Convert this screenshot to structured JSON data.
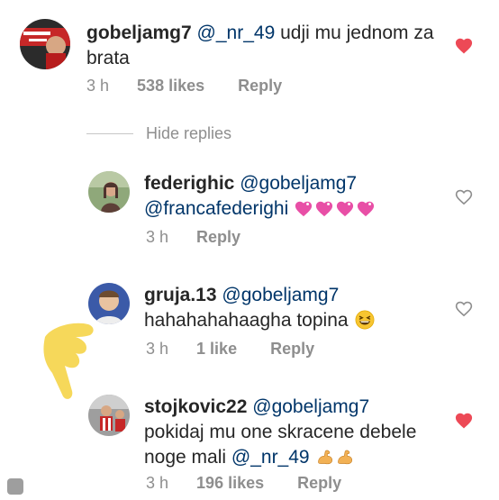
{
  "comments": [
    {
      "username": "gobeljamg7",
      "mention": "@_nr_49",
      "text_line1": " udji mu jednom za",
      "text_line2": "brata",
      "time": "3 h",
      "likes": "538 likes",
      "reply_label": "Reply",
      "liked": true
    }
  ],
  "hide_replies_label": "Hide replies",
  "replies": [
    {
      "username": "federighic",
      "mention": "@gobeljamg7",
      "mention2": "@francafederighi",
      "emoji": [
        "sparkling-heart",
        "sparkling-heart",
        "sparkling-heart",
        "sparkling-heart"
      ],
      "time": "3 h",
      "reply_label": "Reply",
      "liked": false
    },
    {
      "username": "gruja.13",
      "mention": "@gobeljamg7",
      "text": "hahahahahaagha topina",
      "emoji": [
        "grinning-squinting-face"
      ],
      "time": "3 h",
      "likes": "1 like",
      "reply_label": "Reply",
      "liked": false
    },
    {
      "username": "stojkovic22",
      "mention": "@gobeljamg7",
      "text_line1": "pokidaj mu one skracene debele",
      "text_line2_prefix": "noge mali ",
      "mention2": "@_nr_49",
      "emoji": [
        "flexed-biceps",
        "flexed-biceps"
      ],
      "time": "3 h",
      "likes": "196 likes",
      "reply_label": "Reply",
      "liked": true
    }
  ],
  "colors": {
    "text": "#262626",
    "mention": "#003569",
    "muted": "#8e8e8e",
    "heart_liked": "#ed4956",
    "heart_outline": "#8e8e8e",
    "pointer_hand": "#f6d85a"
  },
  "icons": {
    "liked": "heart-filled-icon",
    "unliked": "heart-outline-icon",
    "pointer": "pointing-hand-icon"
  }
}
